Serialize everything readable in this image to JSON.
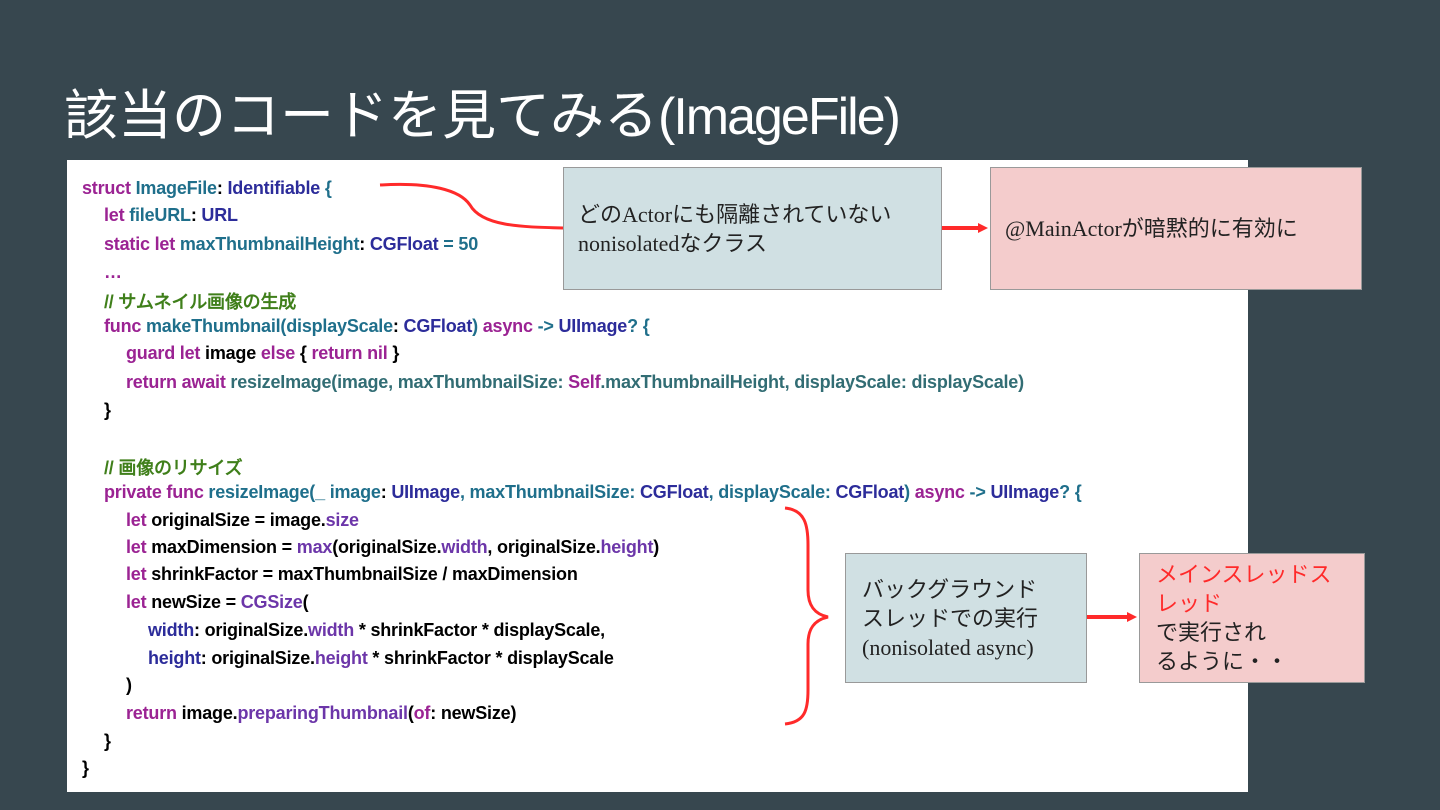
{
  "slide": {
    "title_prefix": "該当のコードを見てみる",
    "title_suffix": "(ImageFile)"
  },
  "code": {
    "l1": {
      "a": "struct",
      "b": " ImageFile",
      "c": ": ",
      "d": "Identifiable",
      "e": " {"
    },
    "l2": {
      "a": "let",
      "b": " fileURL",
      "c": ": ",
      "d": "URL"
    },
    "l3": {
      "a": "static let",
      "b": " maxThumbnailHeight",
      "c": ": ",
      "d": "CGFloat",
      "e": " = 50"
    },
    "l4": {
      "a": "…"
    },
    "l5": {
      "a": "// サムネイル画像の生成"
    },
    "l6": {
      "a": "func",
      "b": " makeThumbnail(displayScale",
      "c": ": ",
      "d": "CGFloat",
      "e": ") ",
      "f": "async",
      "g": " -> ",
      "h": "UIImage",
      "i": "? {"
    },
    "l7": {
      "a": "guard let",
      "b": " image ",
      "c": "else",
      "d": " { ",
      "e": "return nil",
      "f": " }"
    },
    "l8": {
      "a": "return await",
      "b": " resizeImage",
      "c": "(image, maxThumbnailSize: ",
      "d": "Self",
      "e": ".maxThumbnailHeight, displayScale: displayScale)"
    },
    "l9": {
      "a": "}"
    },
    "l10": {
      "a": "// 画像のリサイズ"
    },
    "l11": {
      "a": "private func",
      "b": " resizeImage(_ image",
      "c": ": ",
      "d": "UIImage",
      "e": ", maxThumbnailSize: ",
      "f": "CGFloat",
      "g": ", displayScale: ",
      "h": "CGFloat",
      "i": ") ",
      "j": "async",
      "k": " -> ",
      "l": "UIImage",
      "m": "? {"
    },
    "l12": {
      "a": "let",
      "b": " originalSize = image.",
      "c": "size"
    },
    "l13": {
      "a": "let",
      "b": " maxDimension = ",
      "c": "max",
      "d": "(originalSize.",
      "e": "width",
      "f": ", originalSize.",
      "g": "height",
      "h": ")"
    },
    "l14": {
      "a": "let",
      "b": " shrinkFactor = maxThumbnailSize / maxDimension"
    },
    "l15": {
      "a": "let",
      "b": " newSize = ",
      "c": "CGSize",
      "d": "("
    },
    "l16": {
      "a": "width",
      "b": ": originalSize.",
      "c": "width",
      "d": " * shrinkFactor * displayScale,"
    },
    "l17": {
      "a": "height",
      "b": ": originalSize.",
      "c": "height",
      "d": " * shrinkFactor * displayScale"
    },
    "l18": {
      "a": ")"
    },
    "l19": {
      "a": "return",
      "b": " image.",
      "c": "preparingThumbnail",
      "d": "(",
      "e": "of",
      "f": ": newSize)"
    },
    "l20": {
      "a": "}"
    },
    "l21": {
      "a": "}"
    }
  },
  "notes": {
    "no_actor": {
      "line1": "どのActorにも隔離されていない",
      "line2": "nonisolatedなクラス"
    },
    "main_actor": {
      "text": "@MainActorが暗黙的に有効に"
    },
    "background": {
      "line1": "バックグラウンド",
      "line2": "スレッドでの実行",
      "line3": "(nonisolated async)"
    },
    "main_thread": {
      "red1": "メインスレッドス",
      "red2": "レッド",
      "rest2": "で実行され",
      "line3": "るように・・"
    }
  },
  "colors": {
    "background": "#37474f",
    "annotation_red": "#ff2a2a",
    "note_blue": "#d0e0e3",
    "note_pink": "#f4cccc"
  }
}
